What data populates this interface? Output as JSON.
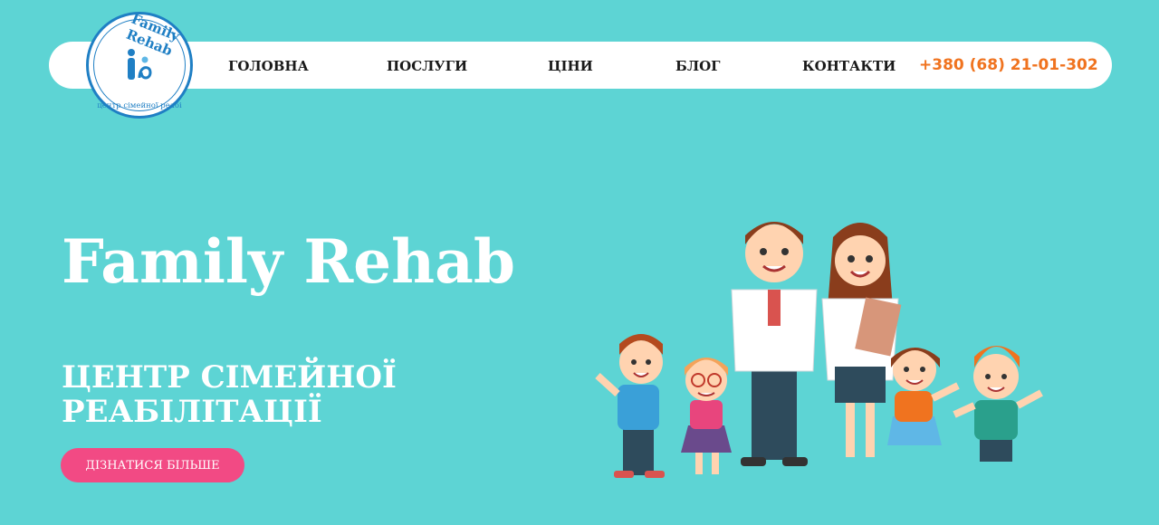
{
  "brand": {
    "logo_name": "Family Rehab",
    "logo_subtitle": "центр сімейної реабі"
  },
  "nav": {
    "items": [
      {
        "label": "ГОЛОВНА"
      },
      {
        "label": "ПОСЛУГИ"
      },
      {
        "label": "ЦІНИ"
      },
      {
        "label": "БЛОГ"
      },
      {
        "label": "КОНТАКТИ"
      }
    ],
    "phone": "+380 (68) 21-01-302"
  },
  "hero": {
    "title": "Family Rehab",
    "subtitle": "ЦЕНТР СІМЕЙНОЇ РЕАБІЛІТАЦІЇ",
    "cta_label": "ДІЗНАТИСЯ БІЛЬШЕ"
  },
  "colors": {
    "background": "#5dd4d4",
    "nav_background": "#ffffff",
    "phone": "#f0731f",
    "cta": "#f24a84",
    "logo": "#1f7fc4"
  },
  "icons": {
    "logo_emblem": "family-emblem-icon",
    "illustration": "doctors-and-children-illustration"
  }
}
